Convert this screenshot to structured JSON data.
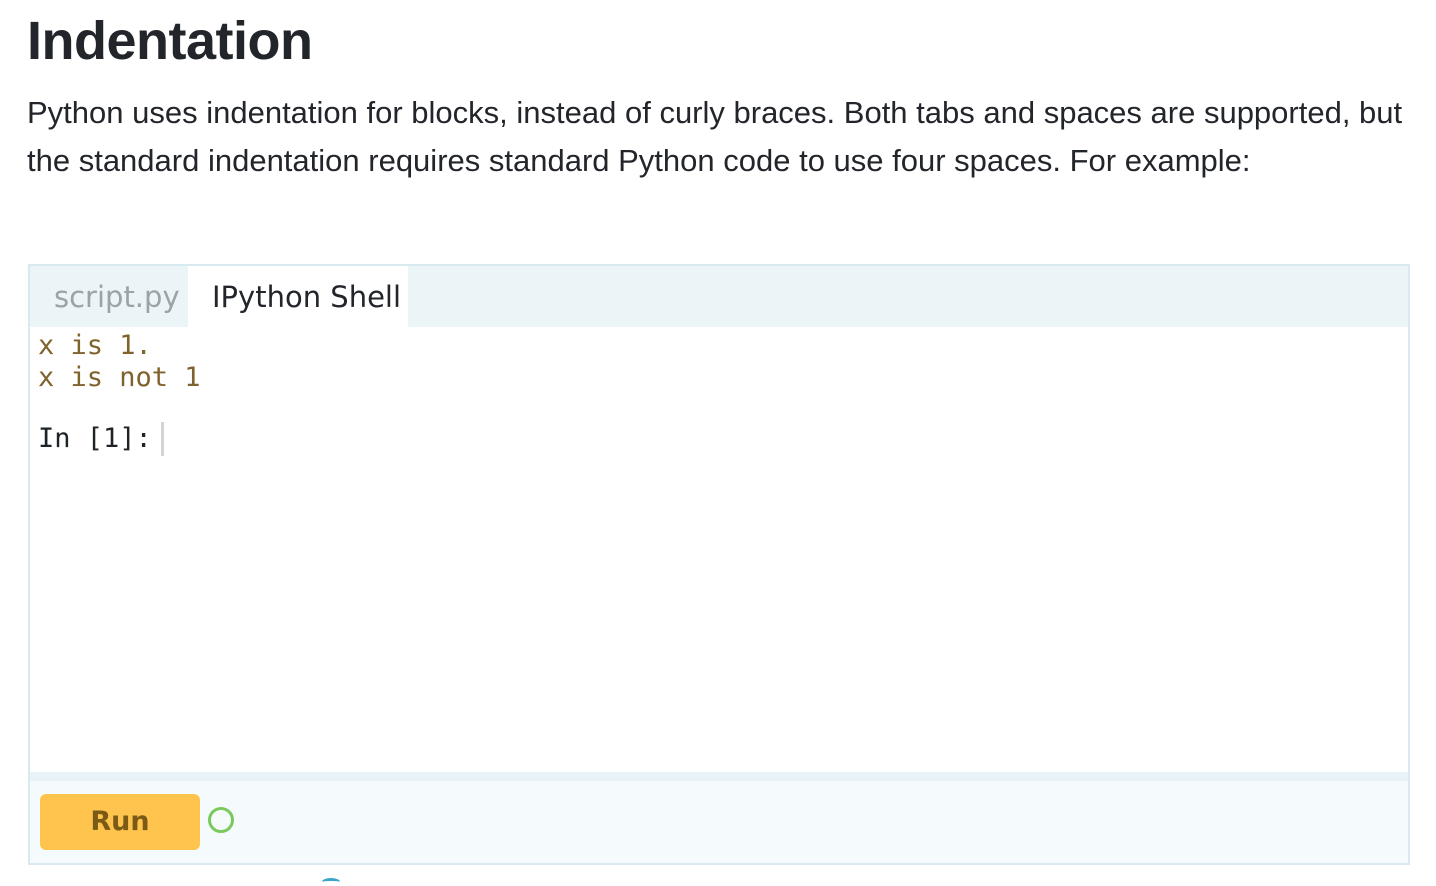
{
  "section": {
    "title": "Indentation",
    "description": "Python uses indentation for blocks, instead of curly braces. Both tabs and spaces are supported, but the standard indentation requires standard Python code to use four spaces. For example:"
  },
  "editor": {
    "tabs": [
      {
        "label": "script.py",
        "active": false
      },
      {
        "label": "IPython Shell",
        "active": true
      }
    ],
    "console": {
      "output_lines": [
        "x is 1.",
        "x is not 1"
      ],
      "prompt": "In [1]: ",
      "input_value": ""
    },
    "footer": {
      "run_label": "Run",
      "status_icon": "status-ring-icon"
    }
  },
  "colors": {
    "run_button": "#ffc44e",
    "output_text": "#80622c",
    "status_ring": "#7ac95d",
    "tabbar_bg": "#ebf4f7"
  }
}
